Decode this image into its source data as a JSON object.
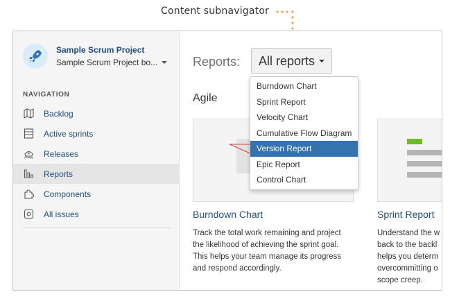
{
  "annotation": {
    "label": "Content subnavigator"
  },
  "project": {
    "name": "Sample Scrum Project",
    "board": "Sample Scrum Project bo...",
    "avatar_icon": "rocket-icon"
  },
  "navigation": {
    "heading": "NAVIGATION",
    "items": [
      {
        "label": "Backlog",
        "icon": "map-icon"
      },
      {
        "label": "Active sprints",
        "icon": "board-icon"
      },
      {
        "label": "Releases",
        "icon": "ship-icon"
      },
      {
        "label": "Reports",
        "icon": "bar-chart-icon",
        "active": true
      },
      {
        "label": "Components",
        "icon": "puzzle-icon"
      },
      {
        "label": "All issues",
        "icon": "issues-icon"
      }
    ]
  },
  "reports": {
    "label": "Reports:",
    "selector_value": "All reports",
    "section_title": "Agile",
    "dropdown": [
      "Burndown Chart",
      "Sprint Report",
      "Velocity Chart",
      "Cumulative Flow Diagram",
      "Version Report",
      "Epic Report",
      "Control Chart"
    ],
    "dropdown_selected": "Version Report",
    "cards": [
      {
        "title": "Burndown Chart",
        "desc": [
          "Track the total work remaining and project",
          "the likelihood of achieving the sprint goal.",
          "This helps your team manage its progress",
          "and respond accordingly."
        ]
      },
      {
        "title": "Sprint Report",
        "desc": [
          "Understand the w",
          "back to the backl",
          "helps you determ",
          "overcommitting o",
          "scope creep."
        ]
      }
    ]
  },
  "colors": {
    "link": "#205081",
    "selected": "#3572b0",
    "annotation_dots": "#f0a64a",
    "sprint_bar_green": "#6bbd28"
  }
}
